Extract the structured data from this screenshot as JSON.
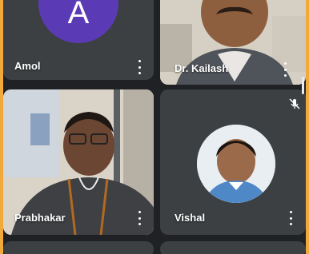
{
  "colors": {
    "border_accent": "#f2a93b",
    "background": "#202124",
    "tile_bg": "#3c4043",
    "avatar_purple": "#5b3bb5"
  },
  "participants": [
    {
      "name": "Amol",
      "avatar_letter": "A",
      "video": false
    },
    {
      "name": "Dr. Kailash",
      "video": true
    },
    {
      "name": "Prabhakar",
      "video": true
    },
    {
      "name": "Vishal",
      "video": false,
      "muted": true
    }
  ],
  "icons": {
    "more": "more-vert-icon",
    "mute": "mic-off-icon"
  }
}
